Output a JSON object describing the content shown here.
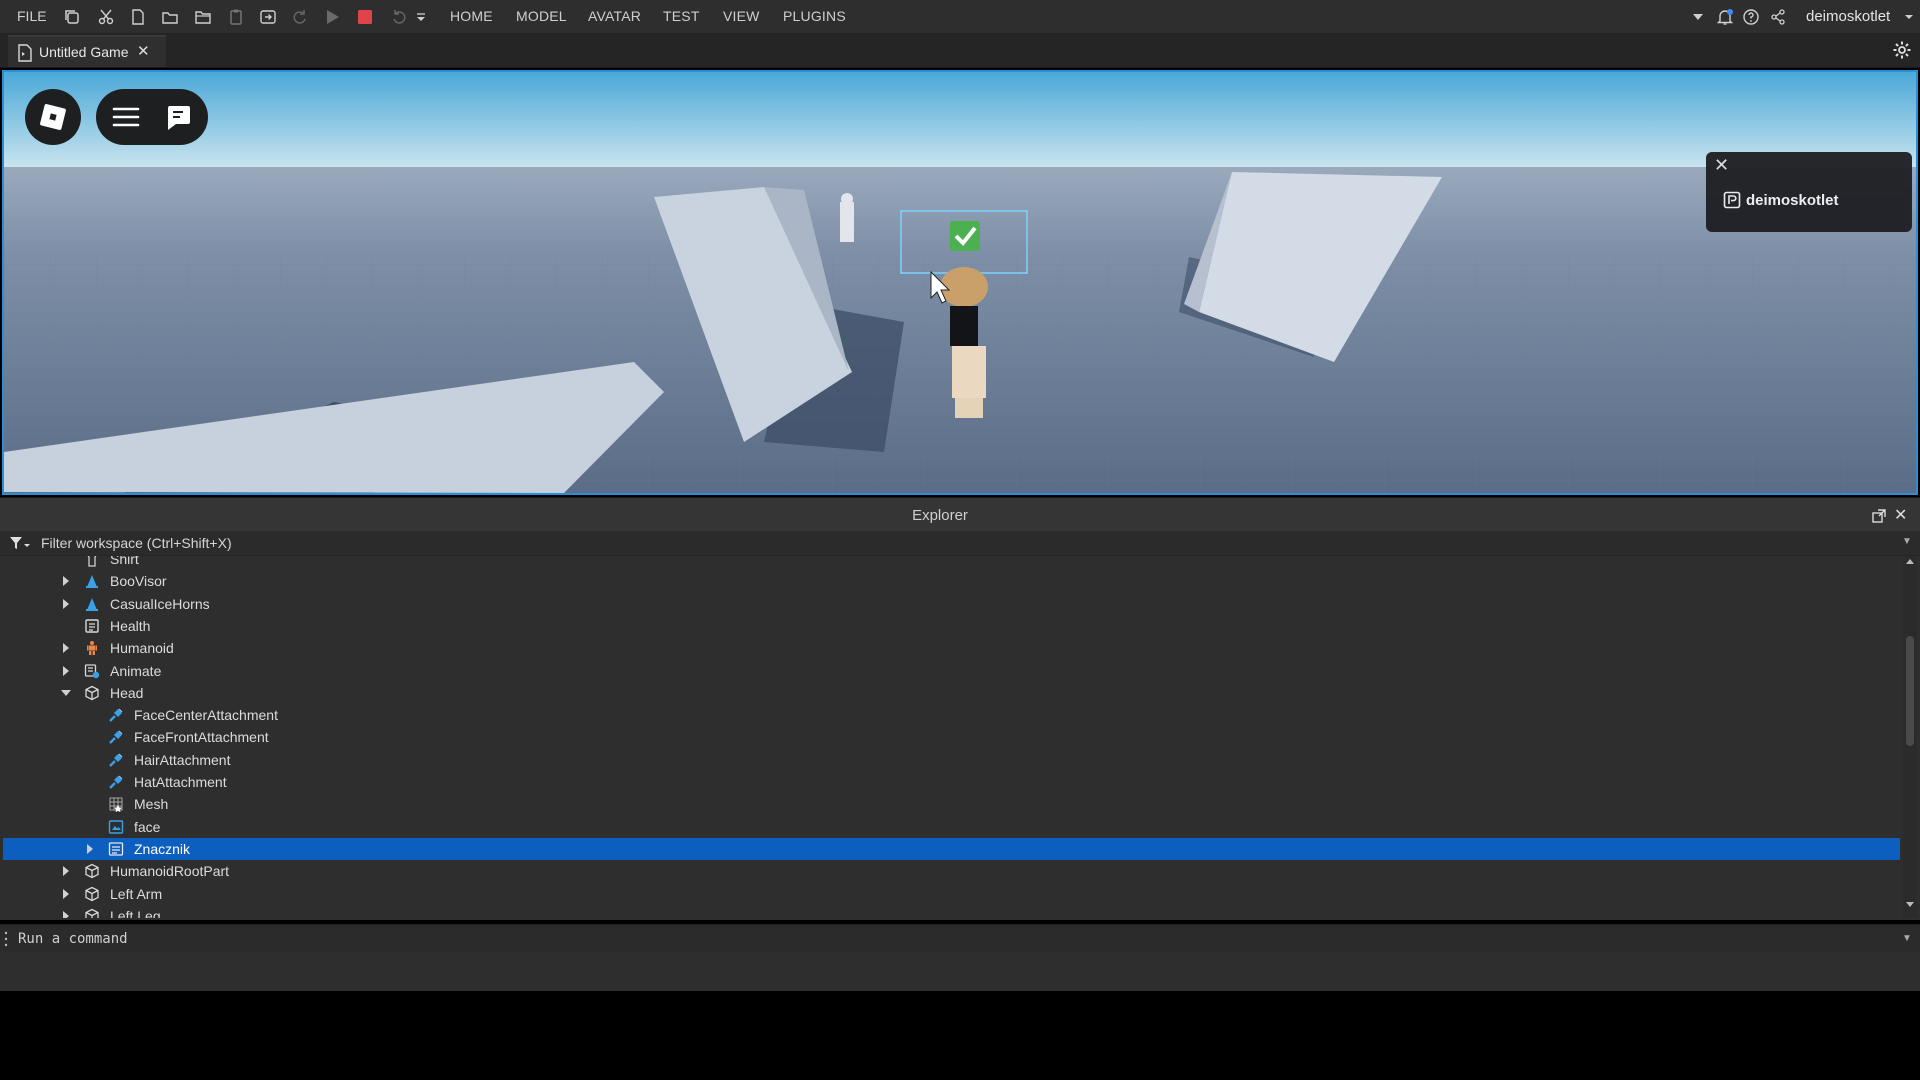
{
  "menu": {
    "file": "FILE"
  },
  "ribbon": {
    "tabs": [
      "HOME",
      "MODEL",
      "AVATAR",
      "TEST",
      "VIEW",
      "PLUGINS"
    ],
    "username": "deimoskotlet"
  },
  "document": {
    "tab_title": "Untitled Game",
    "close_glyph": "✕"
  },
  "viewport": {
    "player_panel": {
      "name": "deimoskotlet",
      "close_glyph": "✕"
    }
  },
  "explorer": {
    "title": "Explorer",
    "filter_placeholder": "Filter workspace (Ctrl+Shift+X)",
    "close_glyph": "✕",
    "items": [
      {
        "label": "Shirt",
        "level": 1,
        "expand": "none",
        "icon": "shirt-icon"
      },
      {
        "label": "BooVisor",
        "level": 1,
        "expand": "collapsed",
        "icon": "accessory-icon"
      },
      {
        "label": "CasualIceHorns",
        "level": 1,
        "expand": "collapsed",
        "icon": "accessory-icon"
      },
      {
        "label": "Health",
        "level": 1,
        "expand": "none",
        "icon": "script-icon"
      },
      {
        "label": "Humanoid",
        "level": 1,
        "expand": "collapsed",
        "icon": "humanoid-icon"
      },
      {
        "label": "Animate",
        "level": 1,
        "expand": "collapsed",
        "icon": "local-script-icon"
      },
      {
        "label": "Head",
        "level": 1,
        "expand": "expanded",
        "icon": "part-icon"
      },
      {
        "label": "FaceCenterAttachment",
        "level": 2,
        "expand": "none",
        "icon": "attachment-icon"
      },
      {
        "label": "FaceFrontAttachment",
        "level": 2,
        "expand": "none",
        "icon": "attachment-icon"
      },
      {
        "label": "HairAttachment",
        "level": 2,
        "expand": "none",
        "icon": "attachment-icon"
      },
      {
        "label": "HatAttachment",
        "level": 2,
        "expand": "none",
        "icon": "attachment-icon"
      },
      {
        "label": "Mesh",
        "level": 2,
        "expand": "none",
        "icon": "mesh-icon"
      },
      {
        "label": "face",
        "level": 2,
        "expand": "none",
        "icon": "decal-icon"
      },
      {
        "label": "Znacznik",
        "level": 2,
        "expand": "collapsed",
        "icon": "billboard-gui-icon",
        "selected": true
      },
      {
        "label": "HumanoidRootPart",
        "level": 1,
        "expand": "collapsed",
        "icon": "part-icon"
      },
      {
        "label": "Left Arm",
        "level": 1,
        "expand": "collapsed",
        "icon": "part-icon"
      },
      {
        "label": "Left Leg",
        "level": 1,
        "expand": "collapsed",
        "icon": "part-icon"
      }
    ]
  },
  "command_bar": {
    "placeholder": "Run a command"
  },
  "colors": {
    "selection": "#0d5fbf",
    "viewport_border": "#2a8fd6",
    "stop_red": "#e0444b",
    "attachment_blue": "#3aa0e8",
    "check_green": "#4caf50"
  }
}
